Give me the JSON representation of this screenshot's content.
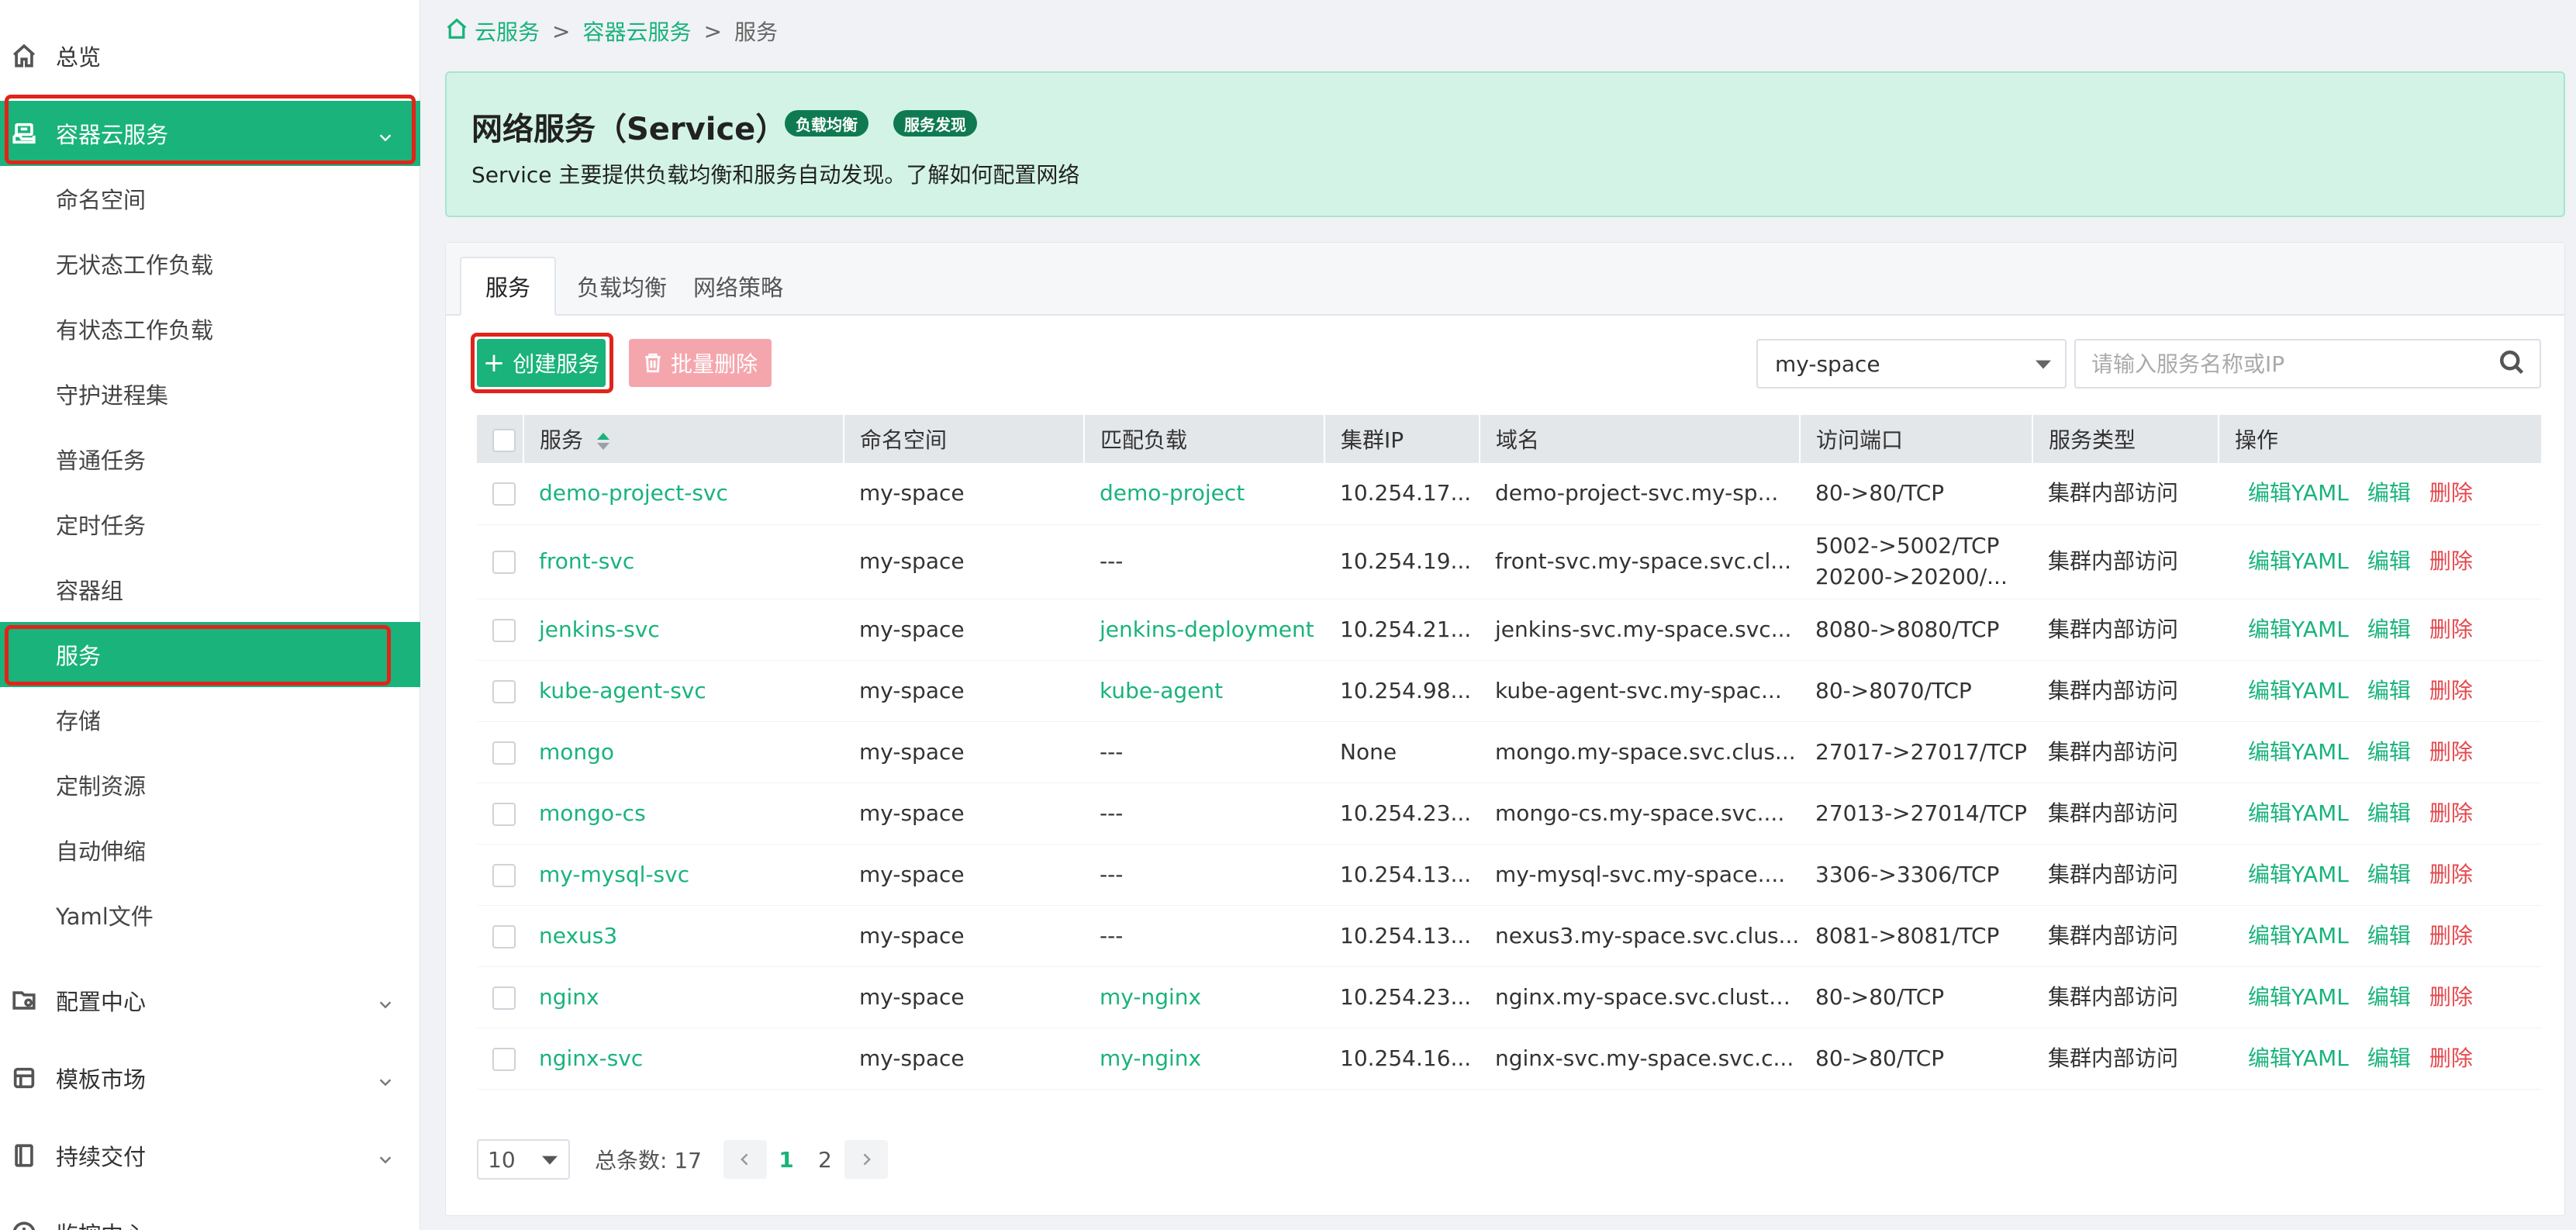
{
  "sidebar": {
    "items": [
      {
        "label": "总览",
        "icon": "home-icon"
      },
      {
        "label": "容器云服务",
        "icon": "container-cloud-icon"
      },
      {
        "label": "配置中心",
        "icon": "config-icon"
      },
      {
        "label": "模板市场",
        "icon": "template-icon"
      },
      {
        "label": "持续交付",
        "icon": "delivery-icon"
      },
      {
        "label": "监控中心",
        "icon": "monitor-icon"
      }
    ],
    "sub_items": [
      "命名空间",
      "无状态工作负载",
      "有状态工作负载",
      "守护进程集",
      "普通任务",
      "定时任务",
      "容器组",
      "服务",
      "存储",
      "定制资源",
      "自动伸缩",
      "Yaml文件"
    ]
  },
  "breadcrumb": {
    "home": "云服务",
    "section": "容器云服务",
    "current": "服务",
    "separator": ">"
  },
  "banner": {
    "title": "网络服务（Service）",
    "badges": [
      "负载均衡",
      "服务发现"
    ],
    "description": "Service 主要提供负载均衡和服务自动发现。了解如何配置网络"
  },
  "tabs": [
    "服务",
    "负载均衡",
    "网络策略"
  ],
  "toolbar": {
    "create_label": "创建服务",
    "delete_label": "批量删除",
    "namespace_value": "my-space",
    "search_placeholder": "请输入服务名称或IP"
  },
  "table": {
    "columns": [
      "服务",
      "命名空间",
      "匹配负载",
      "集群IP",
      "域名",
      "访问端口",
      "服务类型",
      "操作"
    ],
    "ops": [
      "编辑YAML",
      "编辑",
      "删除"
    ],
    "rows": [
      {
        "name": "demo-project-svc",
        "ns": "my-space",
        "workload": "demo-project",
        "ip": "10.254.17...",
        "domain": "demo-project-svc.my-sp...",
        "ports": "80->80/TCP",
        "ports2": "",
        "type": "集群内部访问"
      },
      {
        "name": "front-svc",
        "ns": "my-space",
        "workload": "---",
        "ip": "10.254.19...",
        "domain": "front-svc.my-space.svc.cl...",
        "ports": "5002->5002/TCP",
        "ports2": "20200->20200/...",
        "type": "集群内部访问"
      },
      {
        "name": "jenkins-svc",
        "ns": "my-space",
        "workload": "jenkins-deployment",
        "ip": "10.254.21...",
        "domain": "jenkins-svc.my-space.svc...",
        "ports": "8080->8080/TCP",
        "ports2": "",
        "type": "集群内部访问"
      },
      {
        "name": "kube-agent-svc",
        "ns": "my-space",
        "workload": "kube-agent",
        "ip": "10.254.98...",
        "domain": "kube-agent-svc.my-spac...",
        "ports": "80->8070/TCP",
        "ports2": "",
        "type": "集群内部访问"
      },
      {
        "name": "mongo",
        "ns": "my-space",
        "workload": "---",
        "ip": "None",
        "domain": "mongo.my-space.svc.clus...",
        "ports": "27017->27017/TCP",
        "ports2": "",
        "type": "集群内部访问"
      },
      {
        "name": "mongo-cs",
        "ns": "my-space",
        "workload": "---",
        "ip": "10.254.23...",
        "domain": "mongo-cs.my-space.svc....",
        "ports": "27013->27014/TCP",
        "ports2": "",
        "type": "集群内部访问"
      },
      {
        "name": "my-mysql-svc",
        "ns": "my-space",
        "workload": "---",
        "ip": "10.254.13...",
        "domain": "my-mysql-svc.my-space....",
        "ports": "3306->3306/TCP",
        "ports2": "",
        "type": "集群内部访问"
      },
      {
        "name": "nexus3",
        "ns": "my-space",
        "workload": "---",
        "ip": "10.254.13...",
        "domain": "nexus3.my-space.svc.clus...",
        "ports": "8081->8081/TCP",
        "ports2": "",
        "type": "集群内部访问"
      },
      {
        "name": "nginx",
        "ns": "my-space",
        "workload": "my-nginx",
        "ip": "10.254.23...",
        "domain": "nginx.my-space.svc.cluste...",
        "ports": "80->80/TCP",
        "ports2": "",
        "type": "集群内部访问"
      },
      {
        "name": "nginx-svc",
        "ns": "my-space",
        "workload": "my-nginx",
        "ip": "10.254.16...",
        "domain": "nginx-svc.my-space.svc.c...",
        "ports": "80->80/TCP",
        "ports2": "",
        "type": "集群内部访问"
      }
    ]
  },
  "pagination": {
    "page_size": "10",
    "total_label": "总条数: 17",
    "pages": [
      "1",
      "2"
    ],
    "current_page": "1"
  },
  "colors": {
    "accent": "#19b37b",
    "danger": "#e5484d",
    "highlight": "#e2231a",
    "banner_bg": "#d3f3e6"
  }
}
